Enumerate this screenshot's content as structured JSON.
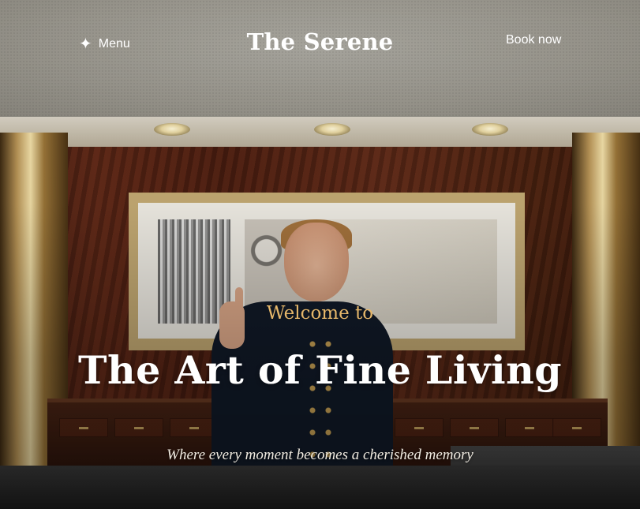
{
  "nav": {
    "menu_icon": "sparkle-icon",
    "menu_label": "Menu",
    "brand": "The Serene",
    "book_label": "Book now"
  },
  "hero": {
    "background_image": "hotel concierge at front desk pointing up",
    "eyebrow": "Welcome to",
    "headline": "The Art of Fine Living",
    "tagline": "Where every moment becomes a cherished memory"
  },
  "colors": {
    "eyebrow": "#e6b76a",
    "text": "#ffffff"
  }
}
